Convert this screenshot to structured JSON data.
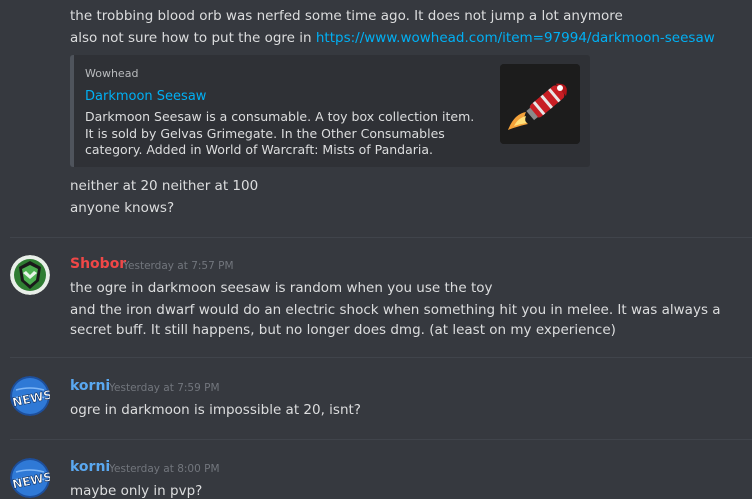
{
  "colors": {
    "background": "#36393f",
    "link": "#00b0f4",
    "shobor_name": "#f04747",
    "korni_name": "#5aa8f0",
    "timestamp": "#72767d"
  },
  "top_messages": [
    "the trobbing blood orb was nerfed some time ago. It does not jump a lot anymore",
    "also not sure how to put the ogre in "
  ],
  "link_url": "https://www.wowhead.com/item=97994/darkmoon-seesaw",
  "embed": {
    "provider": "Wowhead",
    "title": "Darkmoon Seesaw",
    "description": "Darkmoon Seesaw is a consumable. A toy box collection item. It is sold by Gelvas Grimegate. In the Other Consumables category. Added in World of Warcraft: Mists of Pandaria.",
    "thumbnail": "darkmoon-seesaw-rocket-icon"
  },
  "after_embed": [
    "neither at 20 neither at 100",
    "anyone knows?"
  ],
  "groups": [
    {
      "author": "Shobor",
      "avatar": "shobor-shield-avatar",
      "timestamp": "Yesterday at 7:57 PM",
      "messages": [
        "the ogre in darkmoon seesaw is random when you use the toy",
        "and the iron dwarf would do an electric shock when something hit you in melee. It was always a secret buff. It still happens, but no longer does dmg. (at least on my experience)"
      ]
    },
    {
      "author": "korni",
      "avatar": "news-globe-avatar",
      "timestamp": "Yesterday at 7:59 PM",
      "messages": [
        "ogre in darkmoon is impossible at 20, isnt?"
      ]
    },
    {
      "author": "korni",
      "avatar": "news-globe-avatar",
      "timestamp": "Yesterday at 8:00 PM",
      "messages": [
        "maybe only in pvp?"
      ]
    }
  ]
}
